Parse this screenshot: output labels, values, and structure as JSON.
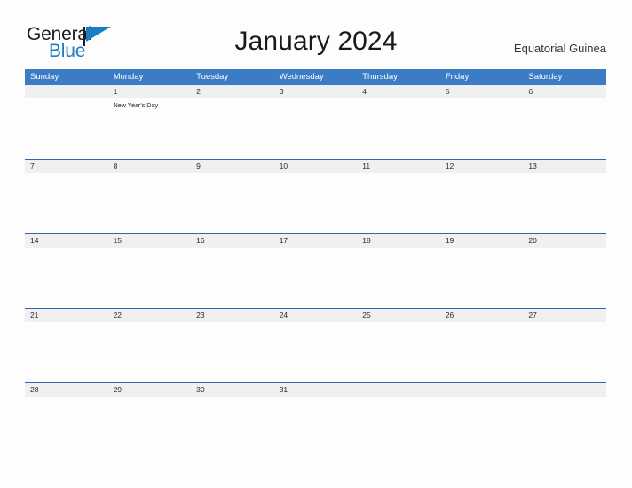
{
  "brand": {
    "word_one": "General",
    "word_two": "Blue",
    "mark_icon": "triangle-flag-icon",
    "accent_color": "#1b7ec4",
    "text_color": "#1c1c1c"
  },
  "header": {
    "title": "January 2024",
    "region": "Equatorial Guinea"
  },
  "colors": {
    "header_blue": "#3b7cc4",
    "rule_blue": "#2a6ab0",
    "date_band_gray": "#f0f0f0",
    "page_background": "#fdfdfd"
  },
  "calendar": {
    "month": "January",
    "year": "2024",
    "weekdays": [
      "Sunday",
      "Monday",
      "Tuesday",
      "Wednesday",
      "Thursday",
      "Friday",
      "Saturday"
    ],
    "weeks": [
      {
        "days": [
          {
            "date": "",
            "events": []
          },
          {
            "date": "1",
            "events": [
              "New Year's Day"
            ]
          },
          {
            "date": "2",
            "events": []
          },
          {
            "date": "3",
            "events": []
          },
          {
            "date": "4",
            "events": []
          },
          {
            "date": "5",
            "events": []
          },
          {
            "date": "6",
            "events": []
          }
        ]
      },
      {
        "days": [
          {
            "date": "7",
            "events": []
          },
          {
            "date": "8",
            "events": []
          },
          {
            "date": "9",
            "events": []
          },
          {
            "date": "10",
            "events": []
          },
          {
            "date": "11",
            "events": []
          },
          {
            "date": "12",
            "events": []
          },
          {
            "date": "13",
            "events": []
          }
        ]
      },
      {
        "days": [
          {
            "date": "14",
            "events": []
          },
          {
            "date": "15",
            "events": []
          },
          {
            "date": "16",
            "events": []
          },
          {
            "date": "17",
            "events": []
          },
          {
            "date": "18",
            "events": []
          },
          {
            "date": "19",
            "events": []
          },
          {
            "date": "20",
            "events": []
          }
        ]
      },
      {
        "days": [
          {
            "date": "21",
            "events": []
          },
          {
            "date": "22",
            "events": []
          },
          {
            "date": "23",
            "events": []
          },
          {
            "date": "24",
            "events": []
          },
          {
            "date": "25",
            "events": []
          },
          {
            "date": "26",
            "events": []
          },
          {
            "date": "27",
            "events": []
          }
        ]
      },
      {
        "days": [
          {
            "date": "28",
            "events": []
          },
          {
            "date": "29",
            "events": []
          },
          {
            "date": "30",
            "events": []
          },
          {
            "date": "31",
            "events": []
          },
          {
            "date": "",
            "events": []
          },
          {
            "date": "",
            "events": []
          },
          {
            "date": "",
            "events": []
          }
        ]
      }
    ]
  }
}
